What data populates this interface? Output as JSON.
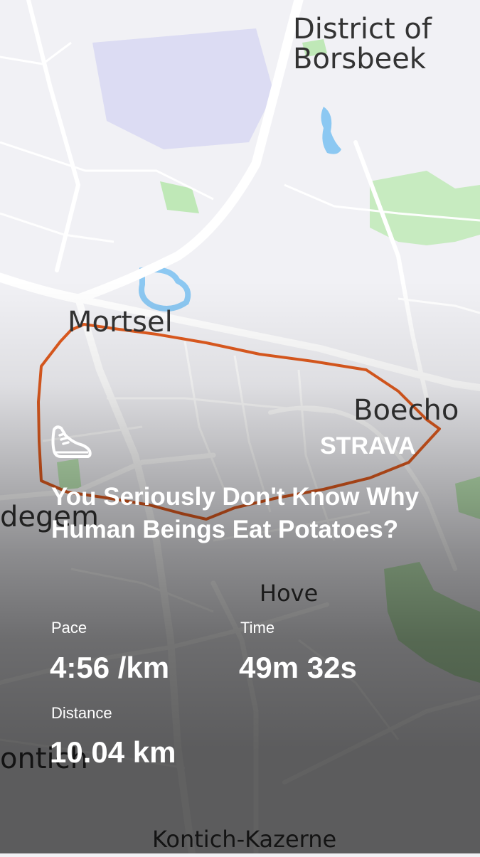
{
  "map": {
    "place_labels": {
      "borsbeek": "District of\nBorsbeek",
      "mortsel": "Mortsel",
      "boechout": "Boecho",
      "edegem": "degem",
      "hove": "Hove",
      "kontich": "ontich",
      "kontich_kazerne": "Kontich-Kazerne"
    },
    "route_color": "#e05b1f",
    "water_color": "#8cc8f2",
    "park_color": "#bfe8b7",
    "airport_color": "#dcdcf2"
  },
  "branding": {
    "logo_text": "STRAVA",
    "activity_icon": "running-shoe-icon"
  },
  "activity": {
    "title": "You Seriously Don't Know Why Human Beings Eat Potatoes?",
    "stats": {
      "pace": {
        "label": "Pace",
        "value": "4:56 /km"
      },
      "time": {
        "label": "Time",
        "value": "49m 32s"
      },
      "distance": {
        "label": "Distance",
        "value": "10.04 km"
      }
    }
  }
}
